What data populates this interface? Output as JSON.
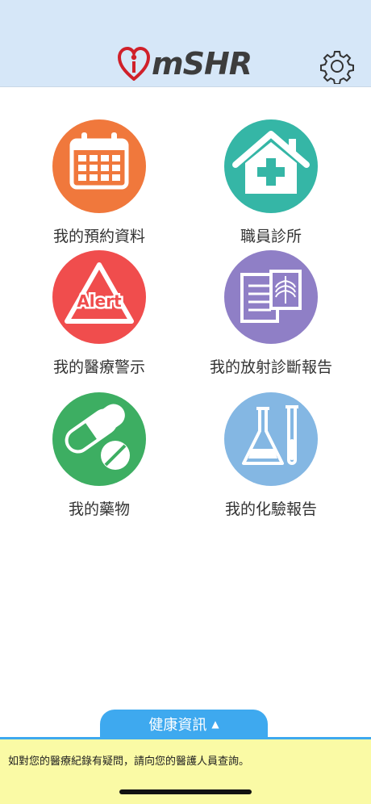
{
  "header": {
    "logo_text": "mSHR",
    "settings_icon": "gear-icon"
  },
  "menu": [
    {
      "label": "我的預約資料",
      "icon": "calendar-icon",
      "color": "#f0783c"
    },
    {
      "label": "職員診所",
      "icon": "clinic-house-icon",
      "color": "#35b6a6"
    },
    {
      "label": "我的醫療警示",
      "icon": "alert-triangle-icon",
      "color": "#f04d4d",
      "icon_text": "Alert"
    },
    {
      "label": "我的放射診斷報告",
      "icon": "xray-report-icon",
      "color": "#8f7fc6"
    },
    {
      "label": "我的藥物",
      "icon": "pills-icon",
      "color": "#3dae62"
    },
    {
      "label": "我的化驗報告",
      "icon": "lab-flask-icon",
      "color": "#84b7e3"
    }
  ],
  "footer": {
    "health_tab_label": "健康資訊",
    "notice": "如對您的醫療紀錄有疑問，請向您的醫護人員查詢。",
    "accent_color": "#3ea9ef",
    "notice_bg": "#fafaa5"
  }
}
